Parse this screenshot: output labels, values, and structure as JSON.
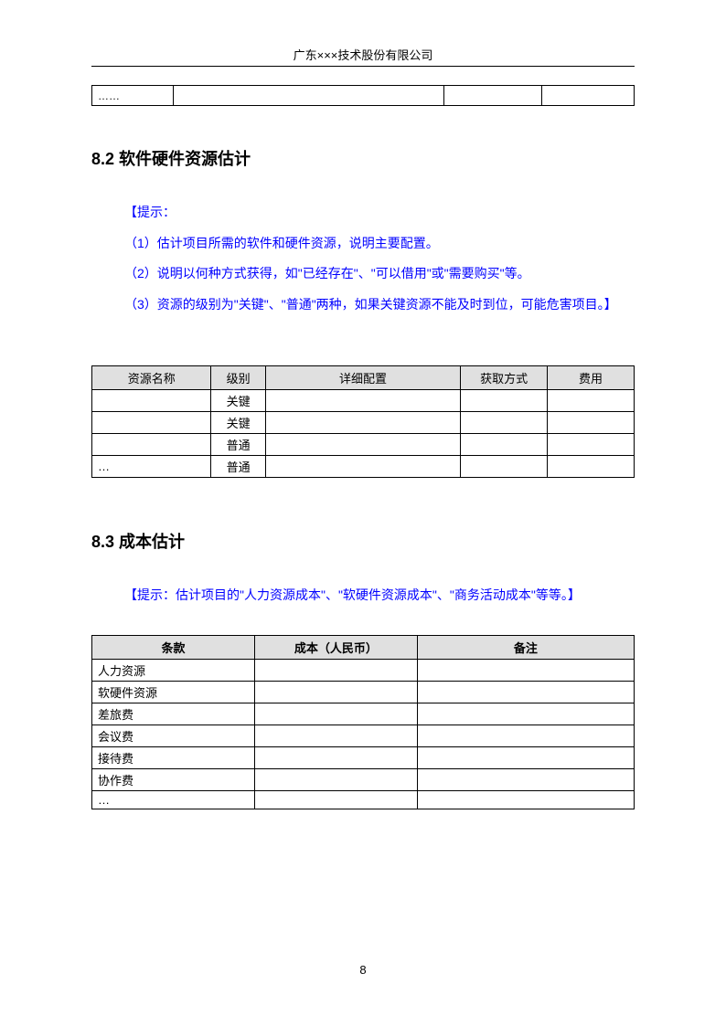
{
  "header": {
    "company": "广东×××技术股份有限公司"
  },
  "topTable": {
    "cell1": "……"
  },
  "section82": {
    "heading": "8.2  软件硬件资源估计",
    "hint_open": "【提示：",
    "hint_1": "（1）估计项目所需的软件和硬件资源，说明主要配置。",
    "hint_2": "（2）说明以何种方式获得，如\"已经存在\"、\"可以借用\"或\"需要购买\"等。",
    "hint_3": "（3）资源的级别为\"关键\"、\"普通\"两种，如果关键资源不能及时到位，可能危害项目。】",
    "table": {
      "headers": {
        "name": "资源名称",
        "level": "级别",
        "config": "详细配置",
        "method": "获取方式",
        "cost": "费用"
      },
      "rows": [
        {
          "name": "",
          "level": "关键"
        },
        {
          "name": "",
          "level": "关键"
        },
        {
          "name": "",
          "level": "普通"
        },
        {
          "name": "…",
          "level": "普通"
        }
      ]
    }
  },
  "section83": {
    "heading": "8.3  成本估计",
    "hint": "【提示：估计项目的\"人力资源成本\"、\"软硬件资源成本\"、\"商务活动成本\"等等。】",
    "table": {
      "headers": {
        "item": "条款",
        "amount": "成本（人民币）",
        "remark": "备注"
      },
      "rows": [
        "人力资源",
        "软硬件资源",
        "差旅费",
        "会议费",
        "接待费",
        "协作费",
        "…"
      ]
    }
  },
  "pageNumber": "8"
}
